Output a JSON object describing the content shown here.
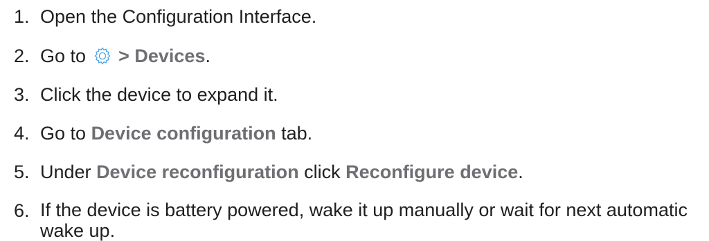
{
  "steps": [
    {
      "num": "1.",
      "text": "Open the Configuration Interface."
    },
    {
      "num": "2.",
      "prefix": "Go to",
      "icon": "gear-icon",
      "separator": ">",
      "target": "Devices",
      "suffix": "."
    },
    {
      "num": "3.",
      "text": "Click the device to expand it."
    },
    {
      "num": "4.",
      "prefix": "Go to",
      "target": "Device configuration",
      "suffix": "tab."
    },
    {
      "num": "5.",
      "prefix": "Under",
      "target": "Device reconfiguration",
      "middle": "click",
      "target2": "Reconfigure device",
      "suffix": "."
    },
    {
      "num": "6.",
      "text": "If the device is battery powered, wake it up manually or wait for next automatic wake up."
    }
  ],
  "colors": {
    "text": "#1f1f1f",
    "ui_label": "#6e6e73",
    "icon_blue": "#4aa3e8"
  }
}
